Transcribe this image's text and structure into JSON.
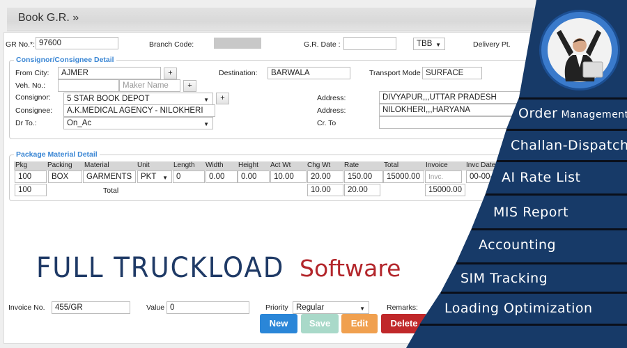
{
  "header": {
    "title": "Book G.R. »"
  },
  "top": {
    "gr_no_label": "GR No.*:",
    "gr_no": "97600",
    "branch_label": "Branch Code:",
    "gr_date_label": "G.R. Date :",
    "gr_date": "",
    "tbb": "TBB",
    "delivery_label": "Delivery Pt."
  },
  "consign": {
    "legend": "Consignor/Consignee Detail",
    "from_city_label": "From City:",
    "from_city": "AJMER",
    "destination_label": "Destination:",
    "destination": "BARWALA",
    "transport_label": "Transport Mode",
    "transport": "SURFACE",
    "veh_label": "Veh. No.:",
    "veh": "",
    "maker_placeholder": "Maker Name",
    "consignor_label": "Consignor:",
    "consignor": "5 STAR BOOK DEPOT",
    "address_label": "Address:",
    "consignor_address": "DIVYAPUR,,,UTTAR PRADESH",
    "consignee_label": "Consignee:",
    "consignee": "A.K.MEDICAL AGENCY - NILOKHERI",
    "consignee_address": "NILOKHERI,,,HARYANA",
    "dr_label": "Dr To.:",
    "dr": "On_Ac",
    "cr_label": "Cr. To",
    "cr": "",
    "plus": "+"
  },
  "package": {
    "legend": "Package Material Detail",
    "columns": [
      "Pkg",
      "Packing",
      "Material",
      "Unit",
      "Length",
      "Width",
      "Height",
      "Act Wt",
      "Chg Wt",
      "Rate",
      "Total",
      "Invoice",
      "Invc Date"
    ],
    "row": [
      "100",
      "BOX",
      "GARMENTS",
      "PKT",
      "0",
      "0.00",
      "0.00",
      "10.00",
      "20.00",
      "150.00",
      "15000.00",
      "",
      "00-00-0"
    ],
    "invoice_placeholder": "Invc.",
    "totals": {
      "pkg": "100",
      "label": "Total",
      "act_wt": "10.00",
      "chg_wt": "20.00",
      "invoice": "15000.00"
    }
  },
  "bottom": {
    "invoice_label": "Invoice No.",
    "invoice": "455/GR",
    "value_label": "Value",
    "value": "0",
    "priority_label": "Priority",
    "priority": "Regular",
    "remarks_label": "Remarks:"
  },
  "buttons": {
    "new": "New",
    "save": "Save",
    "edit": "Edit",
    "delete": "Delete"
  },
  "banner": {
    "title": "FULL TRUCKLOAD",
    "subtitle": "Software"
  },
  "features": [
    {
      "big": "Order",
      "small": " Management"
    },
    "Challan-Dispatch",
    "AI Rate List",
    "MIS Report",
    "Accounting",
    "SIM Tracking",
    "Loading Optimization"
  ],
  "colors": {
    "navy": "#173a68",
    "accent_blue": "#3a86d4",
    "new": "#2a86d8",
    "save": "#a9d9c9",
    "edit": "#f0a04f",
    "delete": "#c0282a",
    "software": "#b3262b"
  }
}
